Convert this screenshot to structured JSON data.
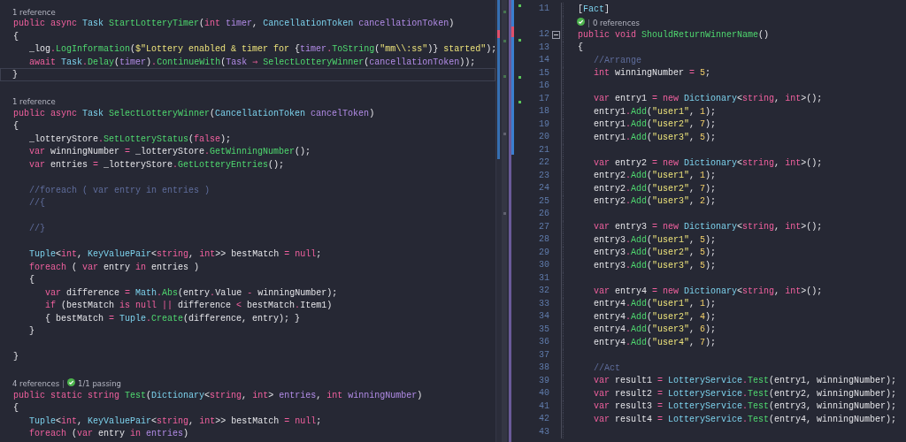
{
  "left_pane": {
    "lines": [
      {
        "kind": "lens",
        "parts": [
          {
            "kind": "text",
            "text": "1 reference"
          }
        ]
      },
      {
        "kind": "code",
        "current": false,
        "tokens": [
          {
            "text": "public async ",
            "kind": "kw"
          },
          {
            "text": "Task ",
            "kind": "type"
          },
          {
            "text": "StartLotteryTimer",
            "kind": "fn"
          },
          {
            "text": "(",
            "kind": "plain"
          },
          {
            "text": "int ",
            "kind": "kw"
          },
          {
            "text": "timer",
            "kind": "param"
          },
          {
            "text": ", ",
            "kind": "plain"
          },
          {
            "text": "CancellationToken ",
            "kind": "type"
          },
          {
            "text": "cancellationToken",
            "kind": "param"
          },
          {
            "text": ")",
            "kind": "plain"
          }
        ]
      },
      {
        "kind": "code",
        "current": false,
        "tokens": [
          {
            "text": "{",
            "kind": "plain"
          }
        ]
      },
      {
        "kind": "code",
        "current": false,
        "tokens": [
          {
            "text": "   _log",
            "kind": "plain"
          },
          {
            "text": ".",
            "kind": "op"
          },
          {
            "text": "LogInformation",
            "kind": "fn"
          },
          {
            "text": "(",
            "kind": "plain"
          },
          {
            "text": "$\"Lottery enabled & timer for ",
            "kind": "str"
          },
          {
            "text": "{",
            "kind": "plain"
          },
          {
            "text": "timer",
            "kind": "param"
          },
          {
            "text": ".",
            "kind": "op"
          },
          {
            "text": "ToString",
            "kind": "fn"
          },
          {
            "text": "(",
            "kind": "plain"
          },
          {
            "text": "\"mm\\\\:ss\"",
            "kind": "str"
          },
          {
            "text": ")}",
            "kind": "plain"
          },
          {
            "text": " started\"",
            "kind": "str"
          },
          {
            "text": ");",
            "kind": "plain"
          }
        ]
      },
      {
        "kind": "code",
        "current": false,
        "tokens": [
          {
            "text": "   await ",
            "kind": "kw"
          },
          {
            "text": "Task",
            "kind": "type"
          },
          {
            "text": ".",
            "kind": "op"
          },
          {
            "text": "Delay",
            "kind": "fn"
          },
          {
            "text": "(",
            "kind": "plain"
          },
          {
            "text": "timer",
            "kind": "param"
          },
          {
            "text": ")",
            "kind": "plain"
          },
          {
            "text": ".",
            "kind": "op"
          },
          {
            "text": "ContinueWith",
            "kind": "fn"
          },
          {
            "text": "(",
            "kind": "plain"
          },
          {
            "text": "Task ",
            "kind": "param"
          },
          {
            "text": "⇒ ",
            "kind": "op"
          },
          {
            "text": "SelectLotteryWinner",
            "kind": "fn"
          },
          {
            "text": "(",
            "kind": "plain"
          },
          {
            "text": "cancellationToken",
            "kind": "param"
          },
          {
            "text": "));",
            "kind": "plain"
          }
        ]
      },
      {
        "kind": "code",
        "current": true,
        "tokens": [
          {
            "text": "}",
            "kind": "plain"
          }
        ]
      },
      {
        "kind": "blank",
        "current": false
      },
      {
        "kind": "lens",
        "parts": [
          {
            "kind": "text",
            "text": "1 reference"
          }
        ]
      },
      {
        "kind": "code",
        "current": false,
        "tokens": [
          {
            "text": "public async ",
            "kind": "kw"
          },
          {
            "text": "Task ",
            "kind": "type"
          },
          {
            "text": "SelectLotteryWinner",
            "kind": "fn"
          },
          {
            "text": "(",
            "kind": "plain"
          },
          {
            "text": "CancellationToken ",
            "kind": "type"
          },
          {
            "text": "cancelToken",
            "kind": "param"
          },
          {
            "text": ")",
            "kind": "plain"
          }
        ]
      },
      {
        "kind": "code",
        "current": false,
        "tokens": [
          {
            "text": "{",
            "kind": "plain"
          }
        ]
      },
      {
        "kind": "code",
        "current": false,
        "tokens": [
          {
            "text": "   _lotteryStore",
            "kind": "plain"
          },
          {
            "text": ".",
            "kind": "op"
          },
          {
            "text": "SetLotteryStatus",
            "kind": "fn"
          },
          {
            "text": "(",
            "kind": "plain"
          },
          {
            "text": "false",
            "kind": "kw"
          },
          {
            "text": ");",
            "kind": "plain"
          }
        ]
      },
      {
        "kind": "code",
        "current": false,
        "tokens": [
          {
            "text": "   var ",
            "kind": "kw"
          },
          {
            "text": "winningNumber ",
            "kind": "plain"
          },
          {
            "text": "= ",
            "kind": "op"
          },
          {
            "text": "_lotteryStore",
            "kind": "plain"
          },
          {
            "text": ".",
            "kind": "op"
          },
          {
            "text": "GetWinningNumber",
            "kind": "fn"
          },
          {
            "text": "();",
            "kind": "plain"
          }
        ]
      },
      {
        "kind": "code",
        "current": false,
        "tokens": [
          {
            "text": "   var ",
            "kind": "kw"
          },
          {
            "text": "entries ",
            "kind": "plain"
          },
          {
            "text": "= ",
            "kind": "op"
          },
          {
            "text": "_lotteryStore",
            "kind": "plain"
          },
          {
            "text": ".",
            "kind": "op"
          },
          {
            "text": "GetLotteryEntries",
            "kind": "fn"
          },
          {
            "text": "();",
            "kind": "plain"
          }
        ]
      },
      {
        "kind": "blank",
        "current": false
      },
      {
        "kind": "code",
        "current": false,
        "tokens": [
          {
            "text": "   //foreach ( var entry in entries )",
            "kind": "cmt"
          }
        ]
      },
      {
        "kind": "code",
        "current": false,
        "tokens": [
          {
            "text": "   //{",
            "kind": "cmt"
          }
        ]
      },
      {
        "kind": "blank",
        "current": false
      },
      {
        "kind": "code",
        "current": false,
        "tokens": [
          {
            "text": "   //}",
            "kind": "cmt"
          }
        ]
      },
      {
        "kind": "blank",
        "current": false
      },
      {
        "kind": "code",
        "current": false,
        "tokens": [
          {
            "text": "   Tuple",
            "kind": "type"
          },
          {
            "text": "<",
            "kind": "plain"
          },
          {
            "text": "int",
            "kind": "kw"
          },
          {
            "text": ", ",
            "kind": "plain"
          },
          {
            "text": "KeyValuePair",
            "kind": "type"
          },
          {
            "text": "<",
            "kind": "plain"
          },
          {
            "text": "string",
            "kind": "kw"
          },
          {
            "text": ", ",
            "kind": "plain"
          },
          {
            "text": "int",
            "kind": "kw"
          },
          {
            "text": ">> bestMatch ",
            "kind": "plain"
          },
          {
            "text": "= ",
            "kind": "op"
          },
          {
            "text": "null",
            "kind": "kw"
          },
          {
            "text": ";",
            "kind": "plain"
          }
        ]
      },
      {
        "kind": "code",
        "current": false,
        "tokens": [
          {
            "text": "   foreach ",
            "kind": "kw"
          },
          {
            "text": "( ",
            "kind": "plain"
          },
          {
            "text": "var ",
            "kind": "kw"
          },
          {
            "text": "entry ",
            "kind": "plain"
          },
          {
            "text": "in ",
            "kind": "kw"
          },
          {
            "text": "entries )",
            "kind": "plain"
          }
        ]
      },
      {
        "kind": "code",
        "current": false,
        "tokens": [
          {
            "text": "   {",
            "kind": "plain"
          }
        ]
      },
      {
        "kind": "code",
        "current": false,
        "tokens": [
          {
            "text": "      var ",
            "kind": "kw"
          },
          {
            "text": "difference ",
            "kind": "plain"
          },
          {
            "text": "= ",
            "kind": "op"
          },
          {
            "text": "Math",
            "kind": "type"
          },
          {
            "text": ".",
            "kind": "op"
          },
          {
            "text": "Abs",
            "kind": "fn"
          },
          {
            "text": "(entry",
            "kind": "plain"
          },
          {
            "text": ".",
            "kind": "op"
          },
          {
            "text": "Value ",
            "kind": "plain"
          },
          {
            "text": "- ",
            "kind": "op"
          },
          {
            "text": "winningNumber);",
            "kind": "plain"
          }
        ]
      },
      {
        "kind": "code",
        "current": false,
        "tokens": [
          {
            "text": "      if ",
            "kind": "kw"
          },
          {
            "text": "(bestMatch ",
            "kind": "plain"
          },
          {
            "text": "is null ",
            "kind": "kw"
          },
          {
            "text": "|| ",
            "kind": "op"
          },
          {
            "text": "difference ",
            "kind": "plain"
          },
          {
            "text": "< ",
            "kind": "op"
          },
          {
            "text": "bestMatch",
            "kind": "plain"
          },
          {
            "text": ".",
            "kind": "op"
          },
          {
            "text": "Item1)",
            "kind": "plain"
          }
        ]
      },
      {
        "kind": "code",
        "current": false,
        "tokens": [
          {
            "text": "      { bestMatch ",
            "kind": "plain"
          },
          {
            "text": "= ",
            "kind": "op"
          },
          {
            "text": "Tuple",
            "kind": "type"
          },
          {
            "text": ".",
            "kind": "op"
          },
          {
            "text": "Create",
            "kind": "fn"
          },
          {
            "text": "(difference, entry); }",
            "kind": "plain"
          }
        ]
      },
      {
        "kind": "code",
        "current": false,
        "tokens": [
          {
            "text": "   }",
            "kind": "plain"
          }
        ]
      },
      {
        "kind": "blank",
        "current": false
      },
      {
        "kind": "code",
        "current": false,
        "tokens": [
          {
            "text": "}",
            "kind": "plain"
          }
        ]
      },
      {
        "kind": "blank",
        "current": false
      },
      {
        "kind": "lens",
        "parts": [
          {
            "kind": "text",
            "text": "4 references"
          },
          {
            "kind": "divider",
            "text": "|"
          },
          {
            "kind": "check"
          },
          {
            "kind": "text",
            "text": "1/1 passing"
          }
        ]
      },
      {
        "kind": "code",
        "current": false,
        "tokens": [
          {
            "text": "public static string ",
            "kind": "kw"
          },
          {
            "text": "Test",
            "kind": "fn"
          },
          {
            "text": "(",
            "kind": "plain"
          },
          {
            "text": "Dictionary",
            "kind": "type"
          },
          {
            "text": "<",
            "kind": "plain"
          },
          {
            "text": "string",
            "kind": "kw"
          },
          {
            "text": ", ",
            "kind": "plain"
          },
          {
            "text": "int",
            "kind": "kw"
          },
          {
            "text": "> ",
            "kind": "plain"
          },
          {
            "text": "entries",
            "kind": "param"
          },
          {
            "text": ", ",
            "kind": "plain"
          },
          {
            "text": "int ",
            "kind": "kw"
          },
          {
            "text": "winningNumber",
            "kind": "param"
          },
          {
            "text": ")",
            "kind": "plain"
          }
        ]
      },
      {
        "kind": "code",
        "current": false,
        "tokens": [
          {
            "text": "{",
            "kind": "plain"
          }
        ]
      },
      {
        "kind": "code",
        "current": false,
        "tokens": [
          {
            "text": "   Tuple",
            "kind": "type"
          },
          {
            "text": "<",
            "kind": "plain"
          },
          {
            "text": "int",
            "kind": "kw"
          },
          {
            "text": ", ",
            "kind": "plain"
          },
          {
            "text": "KeyValuePair",
            "kind": "type"
          },
          {
            "text": "<",
            "kind": "plain"
          },
          {
            "text": "string",
            "kind": "kw"
          },
          {
            "text": ", ",
            "kind": "plain"
          },
          {
            "text": "int",
            "kind": "kw"
          },
          {
            "text": ">> bestMatch ",
            "kind": "plain"
          },
          {
            "text": "= ",
            "kind": "op"
          },
          {
            "text": "null",
            "kind": "kw"
          },
          {
            "text": ";",
            "kind": "plain"
          }
        ]
      },
      {
        "kind": "code",
        "current": false,
        "tokens": [
          {
            "text": "   foreach ",
            "kind": "kw"
          },
          {
            "text": "(",
            "kind": "plain"
          },
          {
            "text": "var ",
            "kind": "kw"
          },
          {
            "text": "entry ",
            "kind": "plain"
          },
          {
            "text": "in ",
            "kind": "kw"
          },
          {
            "text": "entries",
            "kind": "param"
          },
          {
            "text": ")",
            "kind": "plain"
          }
        ]
      }
    ]
  },
  "right_pane": {
    "lines": [
      {
        "kind": "code",
        "number": "11",
        "fold": false,
        "tokens": [
          {
            "text": "[",
            "kind": "plain"
          },
          {
            "text": "Fact",
            "kind": "type"
          },
          {
            "text": "]",
            "kind": "plain"
          }
        ]
      },
      {
        "kind": "lens",
        "parts": [
          {
            "kind": "check"
          },
          {
            "kind": "divider",
            "text": "|"
          },
          {
            "kind": "text",
            "text": "0 references"
          }
        ]
      },
      {
        "kind": "code",
        "number": "12",
        "fold": true,
        "tokens": [
          {
            "text": "public void ",
            "kind": "kw"
          },
          {
            "text": "ShouldReturnWinnerName",
            "kind": "fn"
          },
          {
            "text": "()",
            "kind": "plain"
          }
        ]
      },
      {
        "kind": "code",
        "number": "13",
        "fold": false,
        "tokens": [
          {
            "text": "{",
            "kind": "plain"
          }
        ]
      },
      {
        "kind": "code",
        "number": "14",
        "fold": false,
        "tokens": [
          {
            "text": "   //Arrange",
            "kind": "cmt"
          }
        ]
      },
      {
        "kind": "code",
        "number": "15",
        "fold": false,
        "tokens": [
          {
            "text": "   int ",
            "kind": "kw"
          },
          {
            "text": "winningNumber ",
            "kind": "plain"
          },
          {
            "text": "= ",
            "kind": "op"
          },
          {
            "text": "5",
            "kind": "num"
          },
          {
            "text": ";",
            "kind": "plain"
          }
        ]
      },
      {
        "kind": "blank",
        "number": "16",
        "fold": false
      },
      {
        "kind": "code",
        "number": "17",
        "fold": false,
        "tokens": [
          {
            "text": "   var ",
            "kind": "kw"
          },
          {
            "text": "entry1 ",
            "kind": "plain"
          },
          {
            "text": "= ",
            "kind": "op"
          },
          {
            "text": "new ",
            "kind": "kw"
          },
          {
            "text": "Dictionary",
            "kind": "type"
          },
          {
            "text": "<",
            "kind": "plain"
          },
          {
            "text": "string",
            "kind": "kw"
          },
          {
            "text": ", ",
            "kind": "plain"
          },
          {
            "text": "int",
            "kind": "kw"
          },
          {
            "text": ">();",
            "kind": "plain"
          }
        ]
      },
      {
        "kind": "code",
        "number": "18",
        "fold": false,
        "tokens": [
          {
            "text": "   entry1",
            "kind": "plain"
          },
          {
            "text": ".",
            "kind": "op"
          },
          {
            "text": "Add",
            "kind": "fn"
          },
          {
            "text": "(",
            "kind": "plain"
          },
          {
            "text": "\"user1\"",
            "kind": "str"
          },
          {
            "text": ", ",
            "kind": "plain"
          },
          {
            "text": "1",
            "kind": "num"
          },
          {
            "text": ");",
            "kind": "plain"
          }
        ]
      },
      {
        "kind": "code",
        "number": "19",
        "fold": false,
        "tokens": [
          {
            "text": "   entry1",
            "kind": "plain"
          },
          {
            "text": ".",
            "kind": "op"
          },
          {
            "text": "Add",
            "kind": "fn"
          },
          {
            "text": "(",
            "kind": "plain"
          },
          {
            "text": "\"user2\"",
            "kind": "str"
          },
          {
            "text": ", ",
            "kind": "plain"
          },
          {
            "text": "7",
            "kind": "num"
          },
          {
            "text": ");",
            "kind": "plain"
          }
        ]
      },
      {
        "kind": "code",
        "number": "20",
        "fold": false,
        "tokens": [
          {
            "text": "   entry1",
            "kind": "plain"
          },
          {
            "text": ".",
            "kind": "op"
          },
          {
            "text": "Add",
            "kind": "fn"
          },
          {
            "text": "(",
            "kind": "plain"
          },
          {
            "text": "\"user3\"",
            "kind": "str"
          },
          {
            "text": ", ",
            "kind": "plain"
          },
          {
            "text": "5",
            "kind": "num"
          },
          {
            "text": ");",
            "kind": "plain"
          }
        ]
      },
      {
        "kind": "blank",
        "number": "21",
        "fold": false
      },
      {
        "kind": "code",
        "number": "22",
        "fold": false,
        "tokens": [
          {
            "text": "   var ",
            "kind": "kw"
          },
          {
            "text": "entry2 ",
            "kind": "plain"
          },
          {
            "text": "= ",
            "kind": "op"
          },
          {
            "text": "new ",
            "kind": "kw"
          },
          {
            "text": "Dictionary",
            "kind": "type"
          },
          {
            "text": "<",
            "kind": "plain"
          },
          {
            "text": "string",
            "kind": "kw"
          },
          {
            "text": ", ",
            "kind": "plain"
          },
          {
            "text": "int",
            "kind": "kw"
          },
          {
            "text": ">();",
            "kind": "plain"
          }
        ]
      },
      {
        "kind": "code",
        "number": "23",
        "fold": false,
        "tokens": [
          {
            "text": "   entry2",
            "kind": "plain"
          },
          {
            "text": ".",
            "kind": "op"
          },
          {
            "text": "Add",
            "kind": "fn"
          },
          {
            "text": "(",
            "kind": "plain"
          },
          {
            "text": "\"user1\"",
            "kind": "str"
          },
          {
            "text": ", ",
            "kind": "plain"
          },
          {
            "text": "1",
            "kind": "num"
          },
          {
            "text": ");",
            "kind": "plain"
          }
        ]
      },
      {
        "kind": "code",
        "number": "24",
        "fold": false,
        "tokens": [
          {
            "text": "   entry2",
            "kind": "plain"
          },
          {
            "text": ".",
            "kind": "op"
          },
          {
            "text": "Add",
            "kind": "fn"
          },
          {
            "text": "(",
            "kind": "plain"
          },
          {
            "text": "\"user2\"",
            "kind": "str"
          },
          {
            "text": ", ",
            "kind": "plain"
          },
          {
            "text": "7",
            "kind": "num"
          },
          {
            "text": ");",
            "kind": "plain"
          }
        ]
      },
      {
        "kind": "code",
        "number": "25",
        "fold": false,
        "tokens": [
          {
            "text": "   entry2",
            "kind": "plain"
          },
          {
            "text": ".",
            "kind": "op"
          },
          {
            "text": "Add",
            "kind": "fn"
          },
          {
            "text": "(",
            "kind": "plain"
          },
          {
            "text": "\"user3\"",
            "kind": "str"
          },
          {
            "text": ", ",
            "kind": "plain"
          },
          {
            "text": "2",
            "kind": "num"
          },
          {
            "text": ");",
            "kind": "plain"
          }
        ]
      },
      {
        "kind": "blank",
        "number": "26",
        "fold": false
      },
      {
        "kind": "code",
        "number": "27",
        "fold": false,
        "tokens": [
          {
            "text": "   var ",
            "kind": "kw"
          },
          {
            "text": "entry3 ",
            "kind": "plain"
          },
          {
            "text": "= ",
            "kind": "op"
          },
          {
            "text": "new ",
            "kind": "kw"
          },
          {
            "text": "Dictionary",
            "kind": "type"
          },
          {
            "text": "<",
            "kind": "plain"
          },
          {
            "text": "string",
            "kind": "kw"
          },
          {
            "text": ", ",
            "kind": "plain"
          },
          {
            "text": "int",
            "kind": "kw"
          },
          {
            "text": ">();",
            "kind": "plain"
          }
        ]
      },
      {
        "kind": "code",
        "number": "28",
        "fold": false,
        "tokens": [
          {
            "text": "   entry3",
            "kind": "plain"
          },
          {
            "text": ".",
            "kind": "op"
          },
          {
            "text": "Add",
            "kind": "fn"
          },
          {
            "text": "(",
            "kind": "plain"
          },
          {
            "text": "\"user1\"",
            "kind": "str"
          },
          {
            "text": ", ",
            "kind": "plain"
          },
          {
            "text": "5",
            "kind": "num"
          },
          {
            "text": ");",
            "kind": "plain"
          }
        ]
      },
      {
        "kind": "code",
        "number": "29",
        "fold": false,
        "tokens": [
          {
            "text": "   entry3",
            "kind": "plain"
          },
          {
            "text": ".",
            "kind": "op"
          },
          {
            "text": "Add",
            "kind": "fn"
          },
          {
            "text": "(",
            "kind": "plain"
          },
          {
            "text": "\"user2\"",
            "kind": "str"
          },
          {
            "text": ", ",
            "kind": "plain"
          },
          {
            "text": "5",
            "kind": "num"
          },
          {
            "text": ");",
            "kind": "plain"
          }
        ]
      },
      {
        "kind": "code",
        "number": "30",
        "fold": false,
        "tokens": [
          {
            "text": "   entry3",
            "kind": "plain"
          },
          {
            "text": ".",
            "kind": "op"
          },
          {
            "text": "Add",
            "kind": "fn"
          },
          {
            "text": "(",
            "kind": "plain"
          },
          {
            "text": "\"user3\"",
            "kind": "str"
          },
          {
            "text": ", ",
            "kind": "plain"
          },
          {
            "text": "5",
            "kind": "num"
          },
          {
            "text": ");",
            "kind": "plain"
          }
        ]
      },
      {
        "kind": "blank",
        "number": "31",
        "fold": false
      },
      {
        "kind": "code",
        "number": "32",
        "fold": false,
        "tokens": [
          {
            "text": "   var ",
            "kind": "kw"
          },
          {
            "text": "entry4 ",
            "kind": "plain"
          },
          {
            "text": "= ",
            "kind": "op"
          },
          {
            "text": "new ",
            "kind": "kw"
          },
          {
            "text": "Dictionary",
            "kind": "type"
          },
          {
            "text": "<",
            "kind": "plain"
          },
          {
            "text": "string",
            "kind": "kw"
          },
          {
            "text": ", ",
            "kind": "plain"
          },
          {
            "text": "int",
            "kind": "kw"
          },
          {
            "text": ">();",
            "kind": "plain"
          }
        ]
      },
      {
        "kind": "code",
        "number": "33",
        "fold": false,
        "tokens": [
          {
            "text": "   entry4",
            "kind": "plain"
          },
          {
            "text": ".",
            "kind": "op"
          },
          {
            "text": "Add",
            "kind": "fn"
          },
          {
            "text": "(",
            "kind": "plain"
          },
          {
            "text": "\"user1\"",
            "kind": "str"
          },
          {
            "text": ", ",
            "kind": "plain"
          },
          {
            "text": "1",
            "kind": "num"
          },
          {
            "text": ");",
            "kind": "plain"
          }
        ]
      },
      {
        "kind": "code",
        "number": "34",
        "fold": false,
        "tokens": [
          {
            "text": "   entry4",
            "kind": "plain"
          },
          {
            "text": ".",
            "kind": "op"
          },
          {
            "text": "Add",
            "kind": "fn"
          },
          {
            "text": "(",
            "kind": "plain"
          },
          {
            "text": "\"user2\"",
            "kind": "str"
          },
          {
            "text": ", ",
            "kind": "plain"
          },
          {
            "text": "4",
            "kind": "num"
          },
          {
            "text": ");",
            "kind": "plain"
          }
        ]
      },
      {
        "kind": "code",
        "number": "35",
        "fold": false,
        "tokens": [
          {
            "text": "   entry4",
            "kind": "plain"
          },
          {
            "text": ".",
            "kind": "op"
          },
          {
            "text": "Add",
            "kind": "fn"
          },
          {
            "text": "(",
            "kind": "plain"
          },
          {
            "text": "\"user3\"",
            "kind": "str"
          },
          {
            "text": ", ",
            "kind": "plain"
          },
          {
            "text": "6",
            "kind": "num"
          },
          {
            "text": ");",
            "kind": "plain"
          }
        ]
      },
      {
        "kind": "code",
        "number": "36",
        "fold": false,
        "tokens": [
          {
            "text": "   entry4",
            "kind": "plain"
          },
          {
            "text": ".",
            "kind": "op"
          },
          {
            "text": "Add",
            "kind": "fn"
          },
          {
            "text": "(",
            "kind": "plain"
          },
          {
            "text": "\"user4\"",
            "kind": "str"
          },
          {
            "text": ", ",
            "kind": "plain"
          },
          {
            "text": "7",
            "kind": "num"
          },
          {
            "text": ");",
            "kind": "plain"
          }
        ]
      },
      {
        "kind": "blank",
        "number": "37",
        "fold": false
      },
      {
        "kind": "code",
        "number": "38",
        "fold": false,
        "tokens": [
          {
            "text": "   //Act",
            "kind": "cmt"
          }
        ]
      },
      {
        "kind": "code",
        "number": "39",
        "fold": false,
        "tokens": [
          {
            "text": "   var ",
            "kind": "kw"
          },
          {
            "text": "result1 ",
            "kind": "plain"
          },
          {
            "text": "= ",
            "kind": "op"
          },
          {
            "text": "LotteryService",
            "kind": "type"
          },
          {
            "text": ".",
            "kind": "op"
          },
          {
            "text": "Test",
            "kind": "fn"
          },
          {
            "text": "(entry1, winningNumber);",
            "kind": "plain"
          }
        ]
      },
      {
        "kind": "code",
        "number": "40",
        "fold": false,
        "tokens": [
          {
            "text": "   var ",
            "kind": "kw"
          },
          {
            "text": "result2 ",
            "kind": "plain"
          },
          {
            "text": "= ",
            "kind": "op"
          },
          {
            "text": "LotteryService",
            "kind": "type"
          },
          {
            "text": ".",
            "kind": "op"
          },
          {
            "text": "Test",
            "kind": "fn"
          },
          {
            "text": "(entry2, winningNumber);",
            "kind": "plain"
          }
        ]
      },
      {
        "kind": "code",
        "number": "41",
        "fold": false,
        "tokens": [
          {
            "text": "   var ",
            "kind": "kw"
          },
          {
            "text": "result3 ",
            "kind": "plain"
          },
          {
            "text": "= ",
            "kind": "op"
          },
          {
            "text": "LotteryService",
            "kind": "type"
          },
          {
            "text": ".",
            "kind": "op"
          },
          {
            "text": "Test",
            "kind": "fn"
          },
          {
            "text": "(entry3, winningNumber);",
            "kind": "plain"
          }
        ]
      },
      {
        "kind": "code",
        "number": "42",
        "fold": false,
        "tokens": [
          {
            "text": "   var ",
            "kind": "kw"
          },
          {
            "text": "result4 ",
            "kind": "plain"
          },
          {
            "text": "= ",
            "kind": "op"
          },
          {
            "text": "LotteryService",
            "kind": "type"
          },
          {
            "text": ".",
            "kind": "op"
          },
          {
            "text": "Test",
            "kind": "fn"
          },
          {
            "text": "(entry4, winningNumber);",
            "kind": "plain"
          }
        ]
      },
      {
        "kind": "blank",
        "number": "43",
        "fold": false
      }
    ]
  }
}
